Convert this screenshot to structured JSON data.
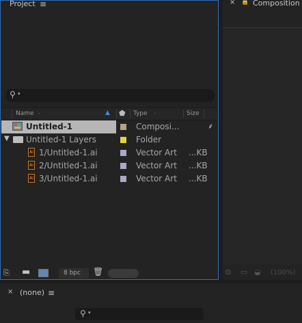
{
  "project": {
    "title": "Project",
    "columns": {
      "name": "Name",
      "type": "Type",
      "size": "Size"
    },
    "items": [
      {
        "name": "Untitled-1",
        "type": "Composi...",
        "size": "",
        "color": "#b5a285"
      },
      {
        "name": "Untitled-1 Layers",
        "type": "Folder",
        "size": "",
        "color": "#e6d23a"
      },
      {
        "name": "1/Untitled-1.ai",
        "type": "Vector Art",
        "size": "...KB",
        "color": "#a9a9c9"
      },
      {
        "name": "2/Untitled-1.ai",
        "type": "Vector Art",
        "size": "...KB",
        "color": "#a9a9c9"
      },
      {
        "name": "3/Untitled-1.ai",
        "type": "Vector Art",
        "size": "...KB",
        "color": "#a9a9c9"
      }
    ],
    "bpc": "8 bpc"
  },
  "composition": {
    "title": "Composition",
    "zoom": "(100%)"
  },
  "timeline": {
    "title": "(none)"
  }
}
